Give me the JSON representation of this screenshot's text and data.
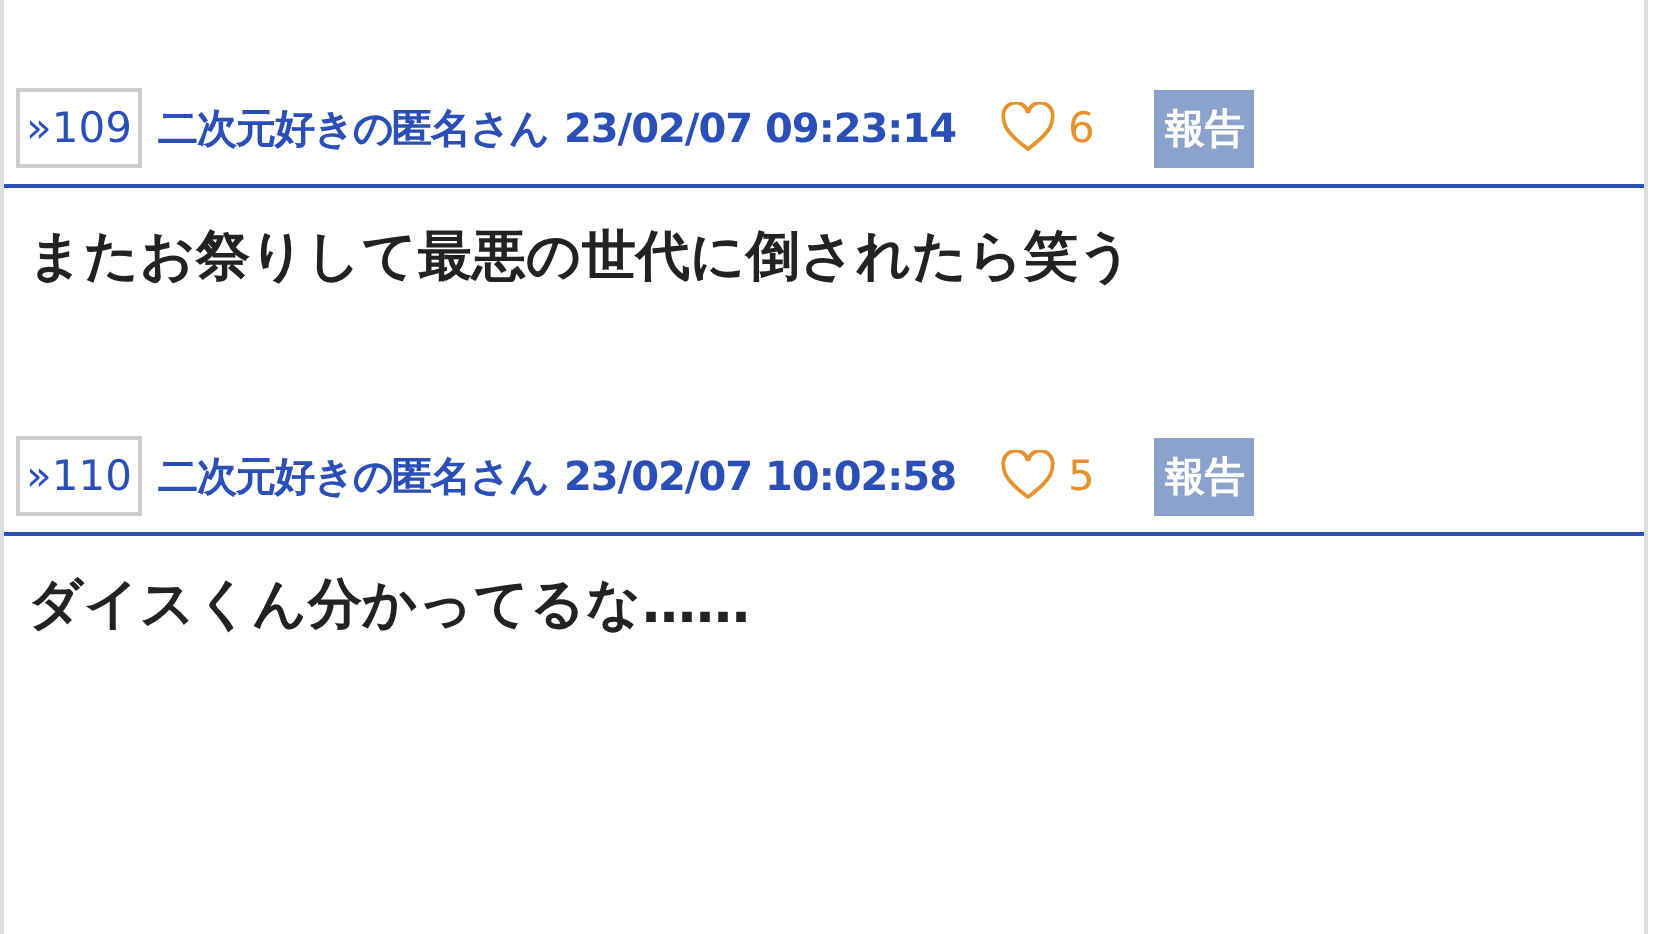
{
  "posts": [
    {
      "number": "»109",
      "author": "二次元好きの匿名さん",
      "date": "23/02/07 09:23:14",
      "likes": "6",
      "report": "報告",
      "body": "またお祭りして最悪の世代に倒されたら笑う"
    },
    {
      "number": "»110",
      "author": "二次元好きの匿名さん",
      "date": "23/02/07 10:02:58",
      "likes": "5",
      "report": "報告",
      "body": "ダイスくん分かってるな……"
    }
  ]
}
